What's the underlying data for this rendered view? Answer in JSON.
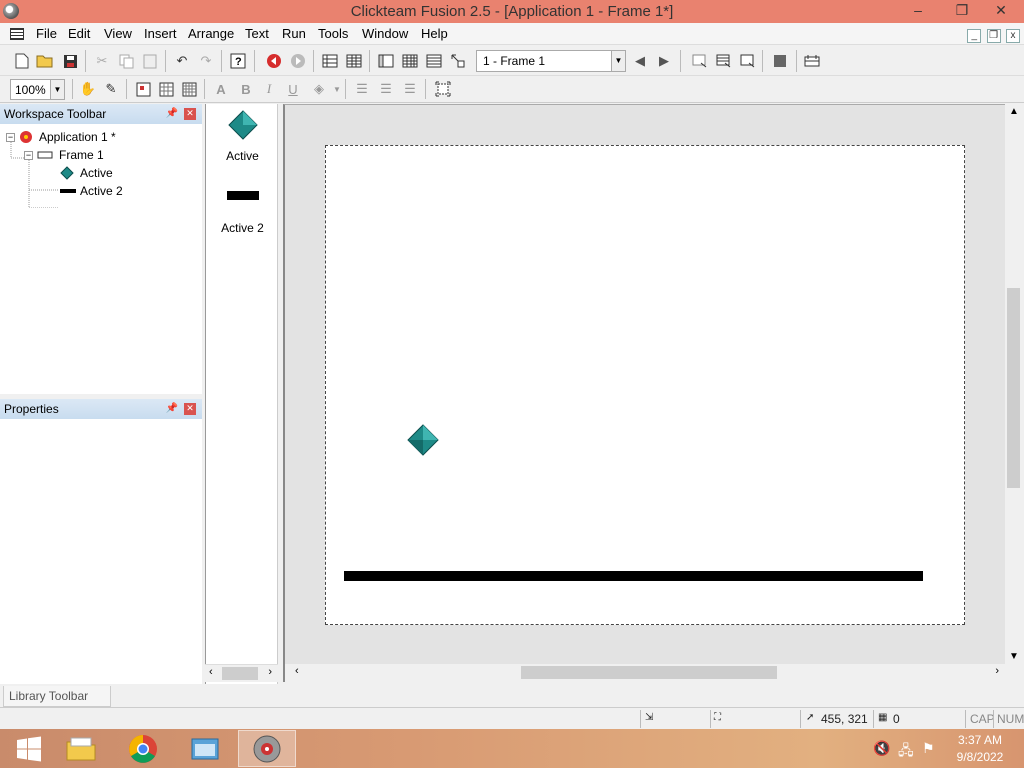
{
  "window": {
    "title": "Clickteam Fusion 2.5 - [Application 1 - Frame 1*]",
    "minimize": "–",
    "maximize": "❐",
    "close": "✕"
  },
  "menu": {
    "items": [
      "File",
      "Edit",
      "View",
      "Insert",
      "Arrange",
      "Text",
      "Run",
      "Tools",
      "Window",
      "Help"
    ],
    "mdi": [
      "_",
      "❐",
      "x"
    ]
  },
  "toolbar": {
    "frame_select": "1 - Frame 1",
    "zoom": "100%",
    "bold": "B",
    "italic": "I",
    "underline": "U"
  },
  "workspace": {
    "title": "Workspace Toolbar",
    "tree": {
      "app": "Application 1 *",
      "frame": "Frame 1",
      "objects": [
        "Active",
        "Active 2"
      ]
    }
  },
  "properties": {
    "title": "Properties"
  },
  "shelf": {
    "items": [
      "Active",
      "Active 2"
    ]
  },
  "library": {
    "tab": "Library Toolbar"
  },
  "status": {
    "coords": "455, 321",
    "count": "0",
    "caps": "CAP",
    "num": "NUM"
  },
  "taskbar": {
    "time": "3:37 AM",
    "date": "9/8/2022"
  },
  "colors": {
    "titlebar": "#e9826f",
    "diamond": "#1e8a87",
    "bar": "#000000"
  }
}
